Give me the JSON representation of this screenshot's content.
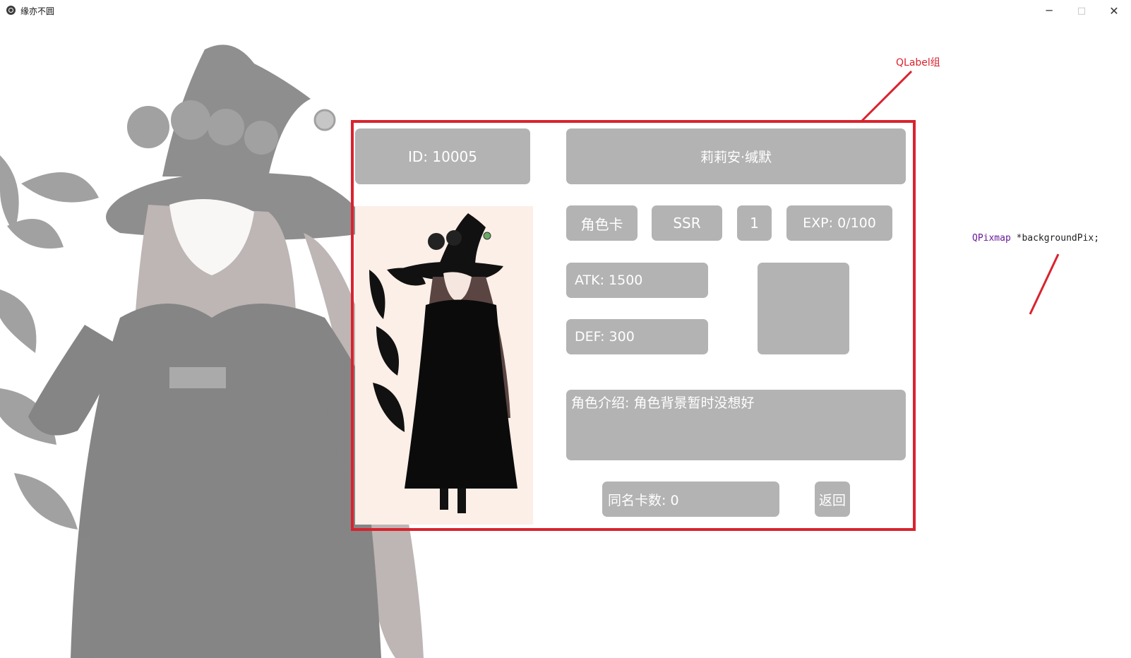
{
  "window": {
    "title": "缘亦不圆",
    "controls": {
      "minimize": "─",
      "maximize": "□",
      "close": "✕"
    }
  },
  "card": {
    "id_label": "ID:   10005",
    "name": "莉莉安·缄默",
    "type": "角色卡",
    "rarity": "SSR",
    "level": "1",
    "exp": "EXP: 0/100",
    "atk": "ATK: 1500",
    "def": "DEF: 300",
    "intro": "角色介绍: 角色背景暂时没想好",
    "duplicates": "同名卡数: 0",
    "back_button": "返回"
  },
  "annotations": {
    "group_label": "QLabel组",
    "pixmap_type": "QPixmap",
    "pixmap_ptr": " *backgroundPix;"
  },
  "colors": {
    "label_bg": "#b3b3b3",
    "frame_red": "#d9232e",
    "card_bg": "#fcefe8"
  }
}
